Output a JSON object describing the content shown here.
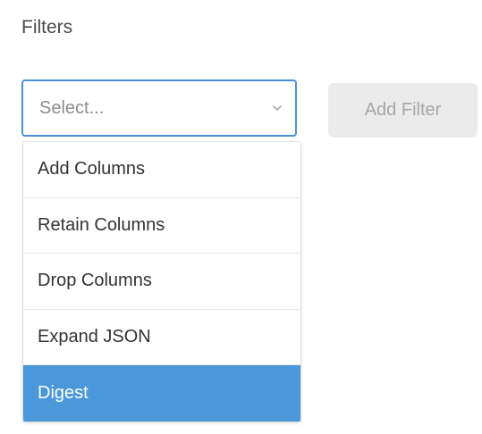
{
  "filters": {
    "title": "Filters",
    "select": {
      "placeholder": "Select..."
    },
    "add_filter_label": "Add Filter",
    "options": [
      {
        "label": "Add Columns",
        "highlighted": false
      },
      {
        "label": "Retain Columns",
        "highlighted": false
      },
      {
        "label": "Drop Columns",
        "highlighted": false
      },
      {
        "label": "Expand JSON",
        "highlighted": false
      },
      {
        "label": "Digest",
        "highlighted": true
      }
    ]
  },
  "colors": {
    "focus_border": "#4a90d9",
    "highlight": "#4a98d9",
    "disabled_button_bg": "#ebebeb",
    "disabled_button_text": "#a6a6a6"
  },
  "icons": {
    "select_chevron": "chevron-down-icon"
  }
}
